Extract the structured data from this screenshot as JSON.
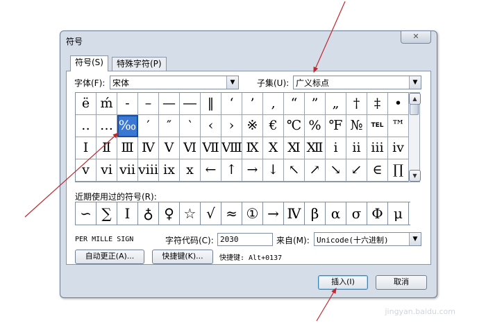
{
  "window": {
    "title": "符号",
    "close_symbol": "✕"
  },
  "tabs": [
    {
      "label": "符号(S)",
      "active": true
    },
    {
      "label": "特殊字符(P)",
      "active": false
    }
  ],
  "font_label": "字体(F):",
  "font_value": "宋体",
  "subset_label": "子集(U):",
  "subset_value": "广义标点",
  "symbols": [
    [
      "ë",
      "ḿ",
      "-",
      "–",
      "—",
      "―",
      "‖",
      "‘",
      "’",
      "‚",
      "“",
      "”",
      "„",
      "†",
      "‡",
      "•"
    ],
    [
      "‥",
      "…",
      "‰",
      "′",
      "″",
      "‵",
      "‹",
      "›",
      "※",
      "€",
      "℃",
      "%",
      "℉",
      "№",
      "TEL",
      "™"
    ],
    [
      "Ⅰ",
      "Ⅱ",
      "Ⅲ",
      "Ⅳ",
      "Ⅴ",
      "Ⅵ",
      "Ⅶ",
      "Ⅷ",
      "Ⅸ",
      "Ⅹ",
      "Ⅺ",
      "Ⅻ",
      "ⅰ",
      "ⅱ",
      "ⅲ",
      "ⅳ"
    ],
    [
      "ⅴ",
      "ⅵ",
      "ⅶ",
      "ⅷ",
      "ⅸ",
      "ⅹ",
      "←",
      "↑",
      "→",
      "↓",
      "↖",
      "↗",
      "↘",
      "↙",
      "∈",
      "∏"
    ]
  ],
  "selected_symbol": "‰",
  "recent_label": "近期使用过的符号(R):",
  "recent_symbols": [
    "∽",
    "∑",
    "Ⅰ",
    "♁",
    "♀",
    "☆",
    "√",
    "≈",
    "①",
    "→",
    "Ⅳ",
    "β",
    "α",
    "σ",
    "Φ",
    "μ"
  ],
  "char_name": "PER MILLE SIGN",
  "char_code_label": "字符代码(C):",
  "char_code_value": "2030",
  "from_label": "来自(M):",
  "from_value": "Unicode(十六进制)",
  "autocorrect_button": "自动更正(A)...",
  "shortcut_button": "快捷键(K)...",
  "shortcut_text": "快捷键: Alt+0137",
  "insert_button": "插入(I)",
  "cancel_button": "取消",
  "watermark": "jingyan.baidu.com",
  "colors": {
    "selection": "#3a78d4",
    "annotation_arrow": "#c0282d"
  }
}
